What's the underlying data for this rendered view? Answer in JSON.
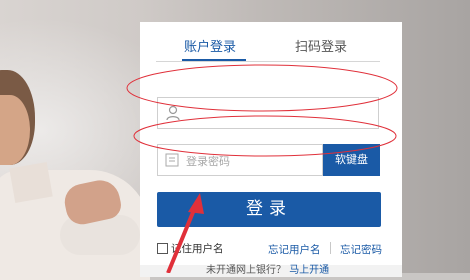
{
  "tabs": [
    {
      "label": "账户登录",
      "active": true
    },
    {
      "label": "扫码登录",
      "active": false
    }
  ],
  "username": {
    "value": "",
    "placeholder": ""
  },
  "password": {
    "value": "",
    "placeholder": "登录密码"
  },
  "soft_keyboard_label": "软键盘",
  "login_label": "登录",
  "remember_label": "记住用户名",
  "forgot_username": "忘记用户名",
  "forgot_password": "忘记密码",
  "footer": {
    "text": "未开通网上银行？",
    "link": "马上开通"
  },
  "colors": {
    "accent": "#1a5aa6",
    "annotation": "#e0303a"
  },
  "icons": {
    "user": "user-icon",
    "lock": "lock-icon"
  }
}
